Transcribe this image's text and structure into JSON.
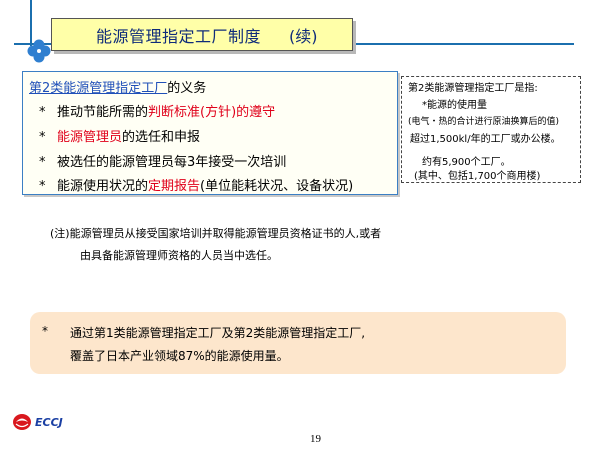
{
  "title": {
    "main": "能源管理指定工厂制度",
    "sub": "(续)"
  },
  "main_box": {
    "heading_highlight": "第2类能源管理指定工厂",
    "heading_rest": "的义务",
    "bullet_marker": "*",
    "bullets": [
      {
        "pre": "推动节能所需的",
        "red": "判断标准(方针)的遵守",
        "post": ""
      },
      {
        "pre": "",
        "red": "能源管理员",
        "post": "的选任和申报"
      },
      {
        "pre": "被选任的能源管理员每3年接受一次培训",
        "red": "",
        "post": ""
      },
      {
        "pre": "能源使用状况的",
        "red": "定期报告",
        "post": "(单位能耗状况、设备状况)"
      }
    ]
  },
  "side_note": {
    "line1": "第2类能源管理指定工厂是指:",
    "line2": "*能源的使用量",
    "line3": "(电气・热的合计进行原油换算后的值)",
    "line4": "超过1,500kl/年的工厂或办公楼。",
    "line5": "约有5,900个工厂。",
    "line6": "(其中、包括1,700个商用楼)"
  },
  "note": {
    "line1": "(注)能源管理员从接受国家培训并取得能源管理员资格证书的人,或者",
    "line2": "由具备能源管理师资格的人员当中选任。"
  },
  "summary": {
    "marker": "*",
    "line1": "通过第1类能源管理指定工厂及第2类能源管理指定工厂,",
    "line2": "覆盖了日本产业领域87%的能源使用量。"
  },
  "logo_text": "ECCJ",
  "page_number": "19",
  "colors": {
    "title_bg": "#ffffa8",
    "accent_blue": "#1f4fb8",
    "highlight_red": "#e0001a",
    "summary_bg": "#fde6cc",
    "clover": "#2f7fd0"
  },
  "icons": {
    "decoration": "clover-icon",
    "logo": "eccj-logo-icon"
  }
}
